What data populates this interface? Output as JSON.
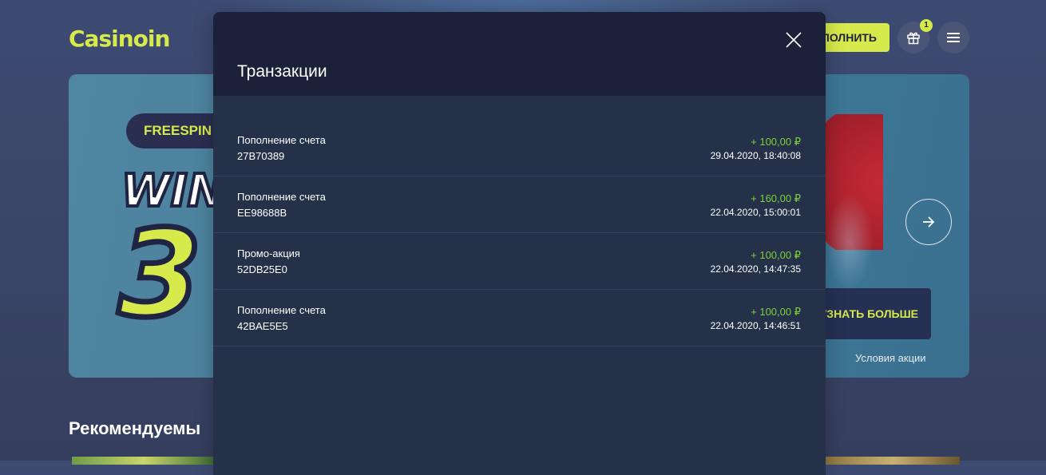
{
  "header": {
    "logo_text": "Casinoin",
    "deposit_label": "ПОЛНИТЬ",
    "gift_badge": "1"
  },
  "banner": {
    "pill_text": "FREESPIN",
    "headline": "WIN",
    "big_number": "3",
    "more_label": "УЗНАТЬ БОЛЬШЕ",
    "terms_label": "Условия акции"
  },
  "section": {
    "title": "Рекомендуемы"
  },
  "modal": {
    "title": "Транзакции",
    "transactions": [
      {
        "title": "Пополнение счета",
        "id": "27B70389",
        "amount": "+ 100,00 ₽",
        "date": "29.04.2020, 18:40:08"
      },
      {
        "title": "Пополнение счета",
        "id": "EE98688B",
        "amount": "+ 160,00 ₽",
        "date": "22.04.2020, 15:00:01"
      },
      {
        "title": "Промо-акция",
        "id": "52DB25E0",
        "amount": "+ 100,00 ₽",
        "date": "22.04.2020, 14:47:35"
      },
      {
        "title": "Пополнение счета",
        "id": "42BAE5E5",
        "amount": "+ 100,00 ₽",
        "date": "22.04.2020, 14:46:51"
      }
    ]
  },
  "icons": {
    "gift": "gift-icon",
    "menu": "hamburger-menu-icon",
    "arrow": "arrow-right-icon",
    "close": "close-icon"
  },
  "colors": {
    "accent": "#d6ea4b",
    "modal_bg": "#243149",
    "modal_header_bg": "#1b2138",
    "amount_positive": "#7ed13a"
  }
}
